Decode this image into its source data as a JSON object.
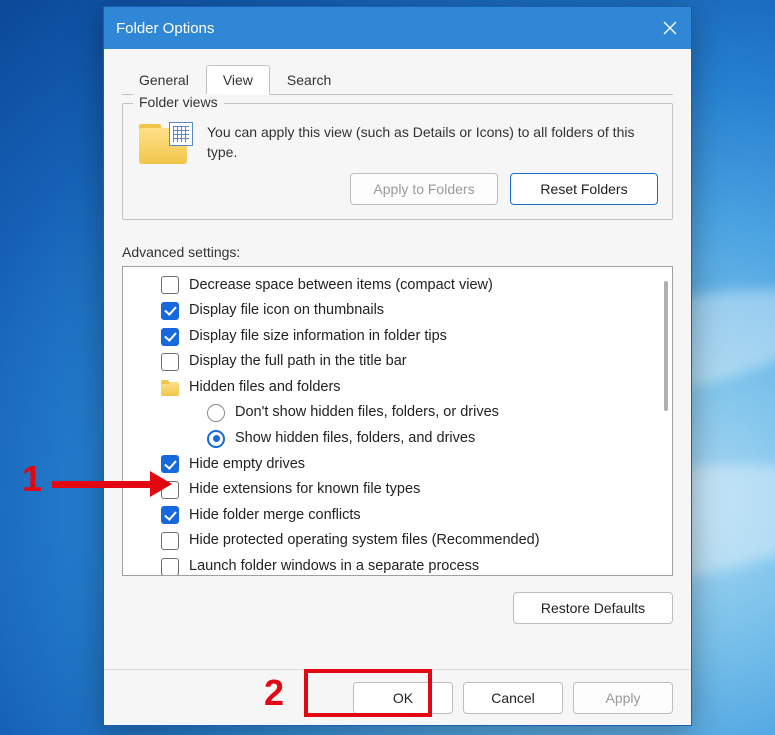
{
  "titlebar": {
    "title": "Folder Options"
  },
  "tabs": {
    "general": "General",
    "view": "View",
    "search": "Search"
  },
  "folder_views": {
    "legend": "Folder views",
    "text": "You can apply this view (such as Details or Icons) to all folders of this type.",
    "apply": "Apply to Folders",
    "reset": "Reset Folders"
  },
  "advanced": {
    "label": "Advanced settings:",
    "items": [
      {
        "type": "check",
        "checked": false,
        "label": "Decrease space between items (compact view)"
      },
      {
        "type": "check",
        "checked": true,
        "label": "Display file icon on thumbnails"
      },
      {
        "type": "check",
        "checked": true,
        "label": "Display file size information in folder tips"
      },
      {
        "type": "check",
        "checked": false,
        "label": "Display the full path in the title bar"
      },
      {
        "type": "group",
        "label": "Hidden files and folders"
      },
      {
        "type": "radio",
        "selected": false,
        "label": "Don't show hidden files, folders, or drives"
      },
      {
        "type": "radio",
        "selected": true,
        "label": "Show hidden files, folders, and drives"
      },
      {
        "type": "check",
        "checked": true,
        "label": "Hide empty drives"
      },
      {
        "type": "check",
        "checked": false,
        "label": "Hide extensions for known file types"
      },
      {
        "type": "check",
        "checked": true,
        "label": "Hide folder merge conflicts"
      },
      {
        "type": "check",
        "checked": false,
        "label": "Hide protected operating system files (Recommended)"
      },
      {
        "type": "check",
        "checked": false,
        "label": "Launch folder windows in a separate process"
      }
    ]
  },
  "restore_defaults": "Restore Defaults",
  "footer": {
    "ok": "OK",
    "cancel": "Cancel",
    "apply": "Apply"
  },
  "annotations": {
    "one": "1",
    "two": "2"
  }
}
